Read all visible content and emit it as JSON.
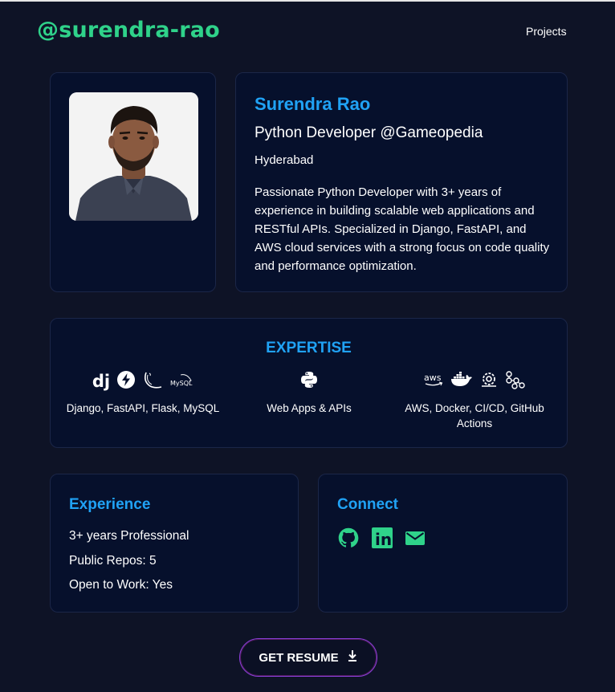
{
  "header": {
    "brand": "@surendra-rao",
    "nav": [
      {
        "label": "Projects"
      }
    ]
  },
  "profile": {
    "name": "Surendra Rao",
    "role": "Python Developer @Gameopedia",
    "location": "Hyderabad",
    "bio": "Passionate Python Developer with 3+ years of experience in building scalable web applications and RESTful APIs. Specialized in Django, FastAPI, and AWS cloud services with a strong focus on code quality and performance optimization."
  },
  "expertise": {
    "title": "EXPERTISE",
    "groups": [
      {
        "label": "Django, FastAPI, Flask, MySQL",
        "icons": [
          "django-icon",
          "fastapi-icon",
          "flask-icon",
          "mysql-icon"
        ],
        "icon_text": {
          "django": "dj",
          "mysql": "MySQL"
        }
      },
      {
        "label": "Web Apps & APIs",
        "icons": [
          "python-icon"
        ]
      },
      {
        "label": "AWS, Docker, CI/CD, GitHub Actions",
        "icons": [
          "aws-icon",
          "docker-icon",
          "cicd-icon",
          "github-actions-icon"
        ],
        "icon_text": {
          "aws": "aws"
        }
      }
    ]
  },
  "experience": {
    "title": "Experience",
    "items": [
      "3+ years Professional",
      "Public Repos: 5",
      "Open to Work: Yes"
    ]
  },
  "connect": {
    "title": "Connect",
    "icons": [
      "github-icon",
      "linkedin-icon",
      "mail-icon"
    ],
    "linkedin_text": "in"
  },
  "resume": {
    "label": "GET RESUME",
    "icon": "download-icon"
  },
  "colors": {
    "background": "#0e1326",
    "card": "#06102c",
    "brand_green": "#2fd28a",
    "accent_blue": "#20a2f5",
    "button_border": "#8a3fd9"
  }
}
